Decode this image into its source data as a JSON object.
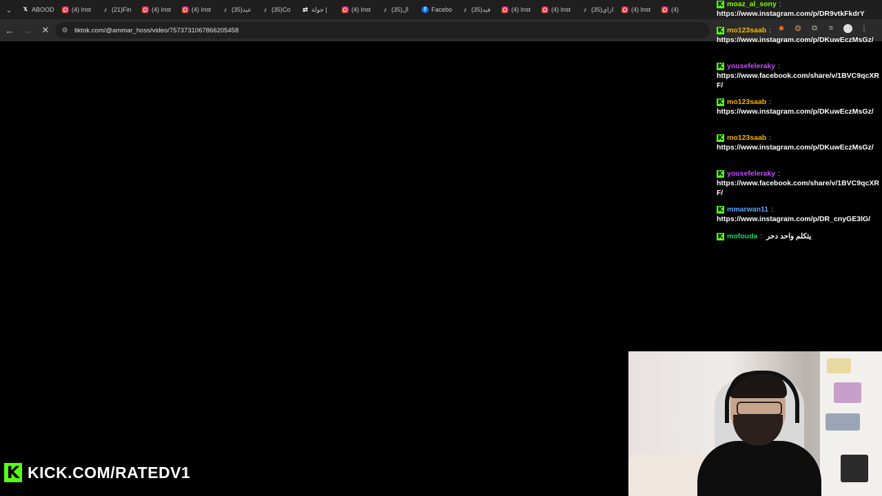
{
  "browser": {
    "tabs": [
      {
        "icon": "x-icon",
        "label": "ABOOD"
      },
      {
        "icon": "instagram-icon",
        "label": "(4) Inst"
      },
      {
        "icon": "tiktok-icon",
        "label": "(21)Fin"
      },
      {
        "icon": "instagram-icon",
        "label": "(4) Inst"
      },
      {
        "icon": "instagram-icon",
        "label": "(4) Inst"
      },
      {
        "icon": "tiktok-icon",
        "label": "(35)عيد"
      },
      {
        "icon": "tiktok-icon",
        "label": "(35)Co"
      },
      {
        "icon": "other-icon",
        "label": "جولة |"
      },
      {
        "icon": "instagram-icon",
        "label": "(4) Inst"
      },
      {
        "icon": "tiktok-icon",
        "label": "(35)ال"
      },
      {
        "icon": "facebook-icon",
        "label": "Facebo"
      },
      {
        "icon": "tiktok-icon",
        "label": "(35)فيد"
      },
      {
        "icon": "instagram-icon",
        "label": "(4) Inst"
      },
      {
        "icon": "instagram-icon",
        "label": "(4) Inst"
      },
      {
        "icon": "tiktok-icon",
        "label": "(35)ازاي"
      },
      {
        "icon": "instagram-icon",
        "label": "(4) Inst"
      },
      {
        "icon": "instagram-icon",
        "label": "(4)"
      }
    ],
    "url": "tiktok.com/@ammar_hoss/video/7573731067866205458"
  },
  "chat": {
    "messages": [
      {
        "user": "moaz_al_sony",
        "color": "#7cfc00",
        "body": "https://www.instagram.com/p/DR9vtkFkdrY",
        "inline": false
      },
      {
        "user": "mo123saab",
        "color": "#f4b400",
        "body": "https://www.instagram.com/p/DKuwEczMsGz/",
        "inline": false
      },
      {
        "user": "yousefeleraky",
        "color": "#c84cff",
        "body": "https://www.facebook.com/share/v/1BVC9qcXRF/",
        "inline": false
      },
      {
        "user": "mo123saab",
        "color": "#f4b400",
        "body": "https://www.instagram.com/p/DKuwEczMsGz/",
        "inline": false
      },
      {
        "user": "mo123saab",
        "color": "#f4b400",
        "body": "https://www.instagram.com/p/DKuwEczMsGz/",
        "inline": false
      },
      {
        "user": "yousefeleraky",
        "color": "#c84cff",
        "body": "https://www.facebook.com/share/v/1BVC9qcXRF/",
        "inline": false
      },
      {
        "user": "mmarwan11",
        "color": "#5aa7ff",
        "body": "https://www.instagram.com/p/DR_cnyGE3lG/",
        "inline": false
      },
      {
        "user": "mofouda",
        "color": "#1ed760",
        "body": "يتكلم واحد دحر",
        "inline": true
      }
    ]
  },
  "branding": {
    "logo_letter": "K",
    "text": "KICK.COM/RATEDV1"
  },
  "colors": {
    "kick_green": "#53fc18"
  }
}
